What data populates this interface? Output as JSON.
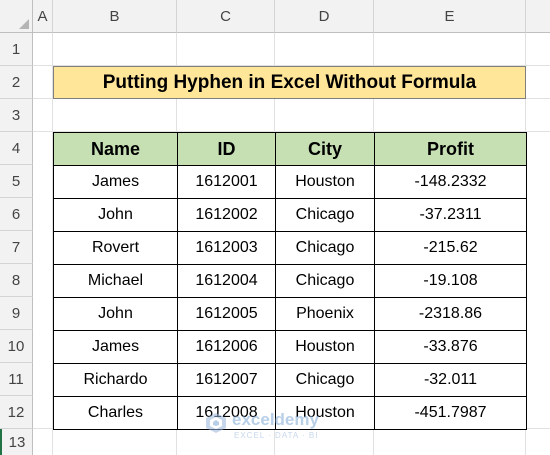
{
  "columns": [
    "A",
    "B",
    "C",
    "D",
    "E"
  ],
  "rows": [
    "1",
    "2",
    "3",
    "4",
    "5",
    "6",
    "7",
    "8",
    "9",
    "10",
    "11",
    "12",
    "13"
  ],
  "title": "Putting Hyphen in Excel Without Formula",
  "table": {
    "headers": [
      "Name",
      "ID",
      "City",
      "Profit"
    ],
    "rows": [
      [
        "James",
        "1612001",
        "Houston",
        "-148.2332"
      ],
      [
        "John",
        "1612002",
        "Chicago",
        "-37.2311"
      ],
      [
        "Rovert",
        "1612003",
        "Chicago",
        "-215.62"
      ],
      [
        "Michael",
        "1612004",
        "Chicago",
        "-19.108"
      ],
      [
        "John",
        "1612005",
        "Phoenix",
        "-2318.86"
      ],
      [
        "James",
        "1612006",
        "Houston",
        "-33.876"
      ],
      [
        "Richardo",
        "1612007",
        "Chicago",
        "-32.011"
      ],
      [
        "Charles",
        "1612008",
        "Houston",
        "-451.7987"
      ]
    ]
  },
  "watermark": {
    "name": "exceldemy",
    "tagline": "EXCEL · DATA · BI",
    "icon": "exceldemy-logo-icon"
  },
  "colors": {
    "title_fill": "#ffe699",
    "header_fill": "#c6e0b4",
    "active_row_marker": "#217346"
  }
}
